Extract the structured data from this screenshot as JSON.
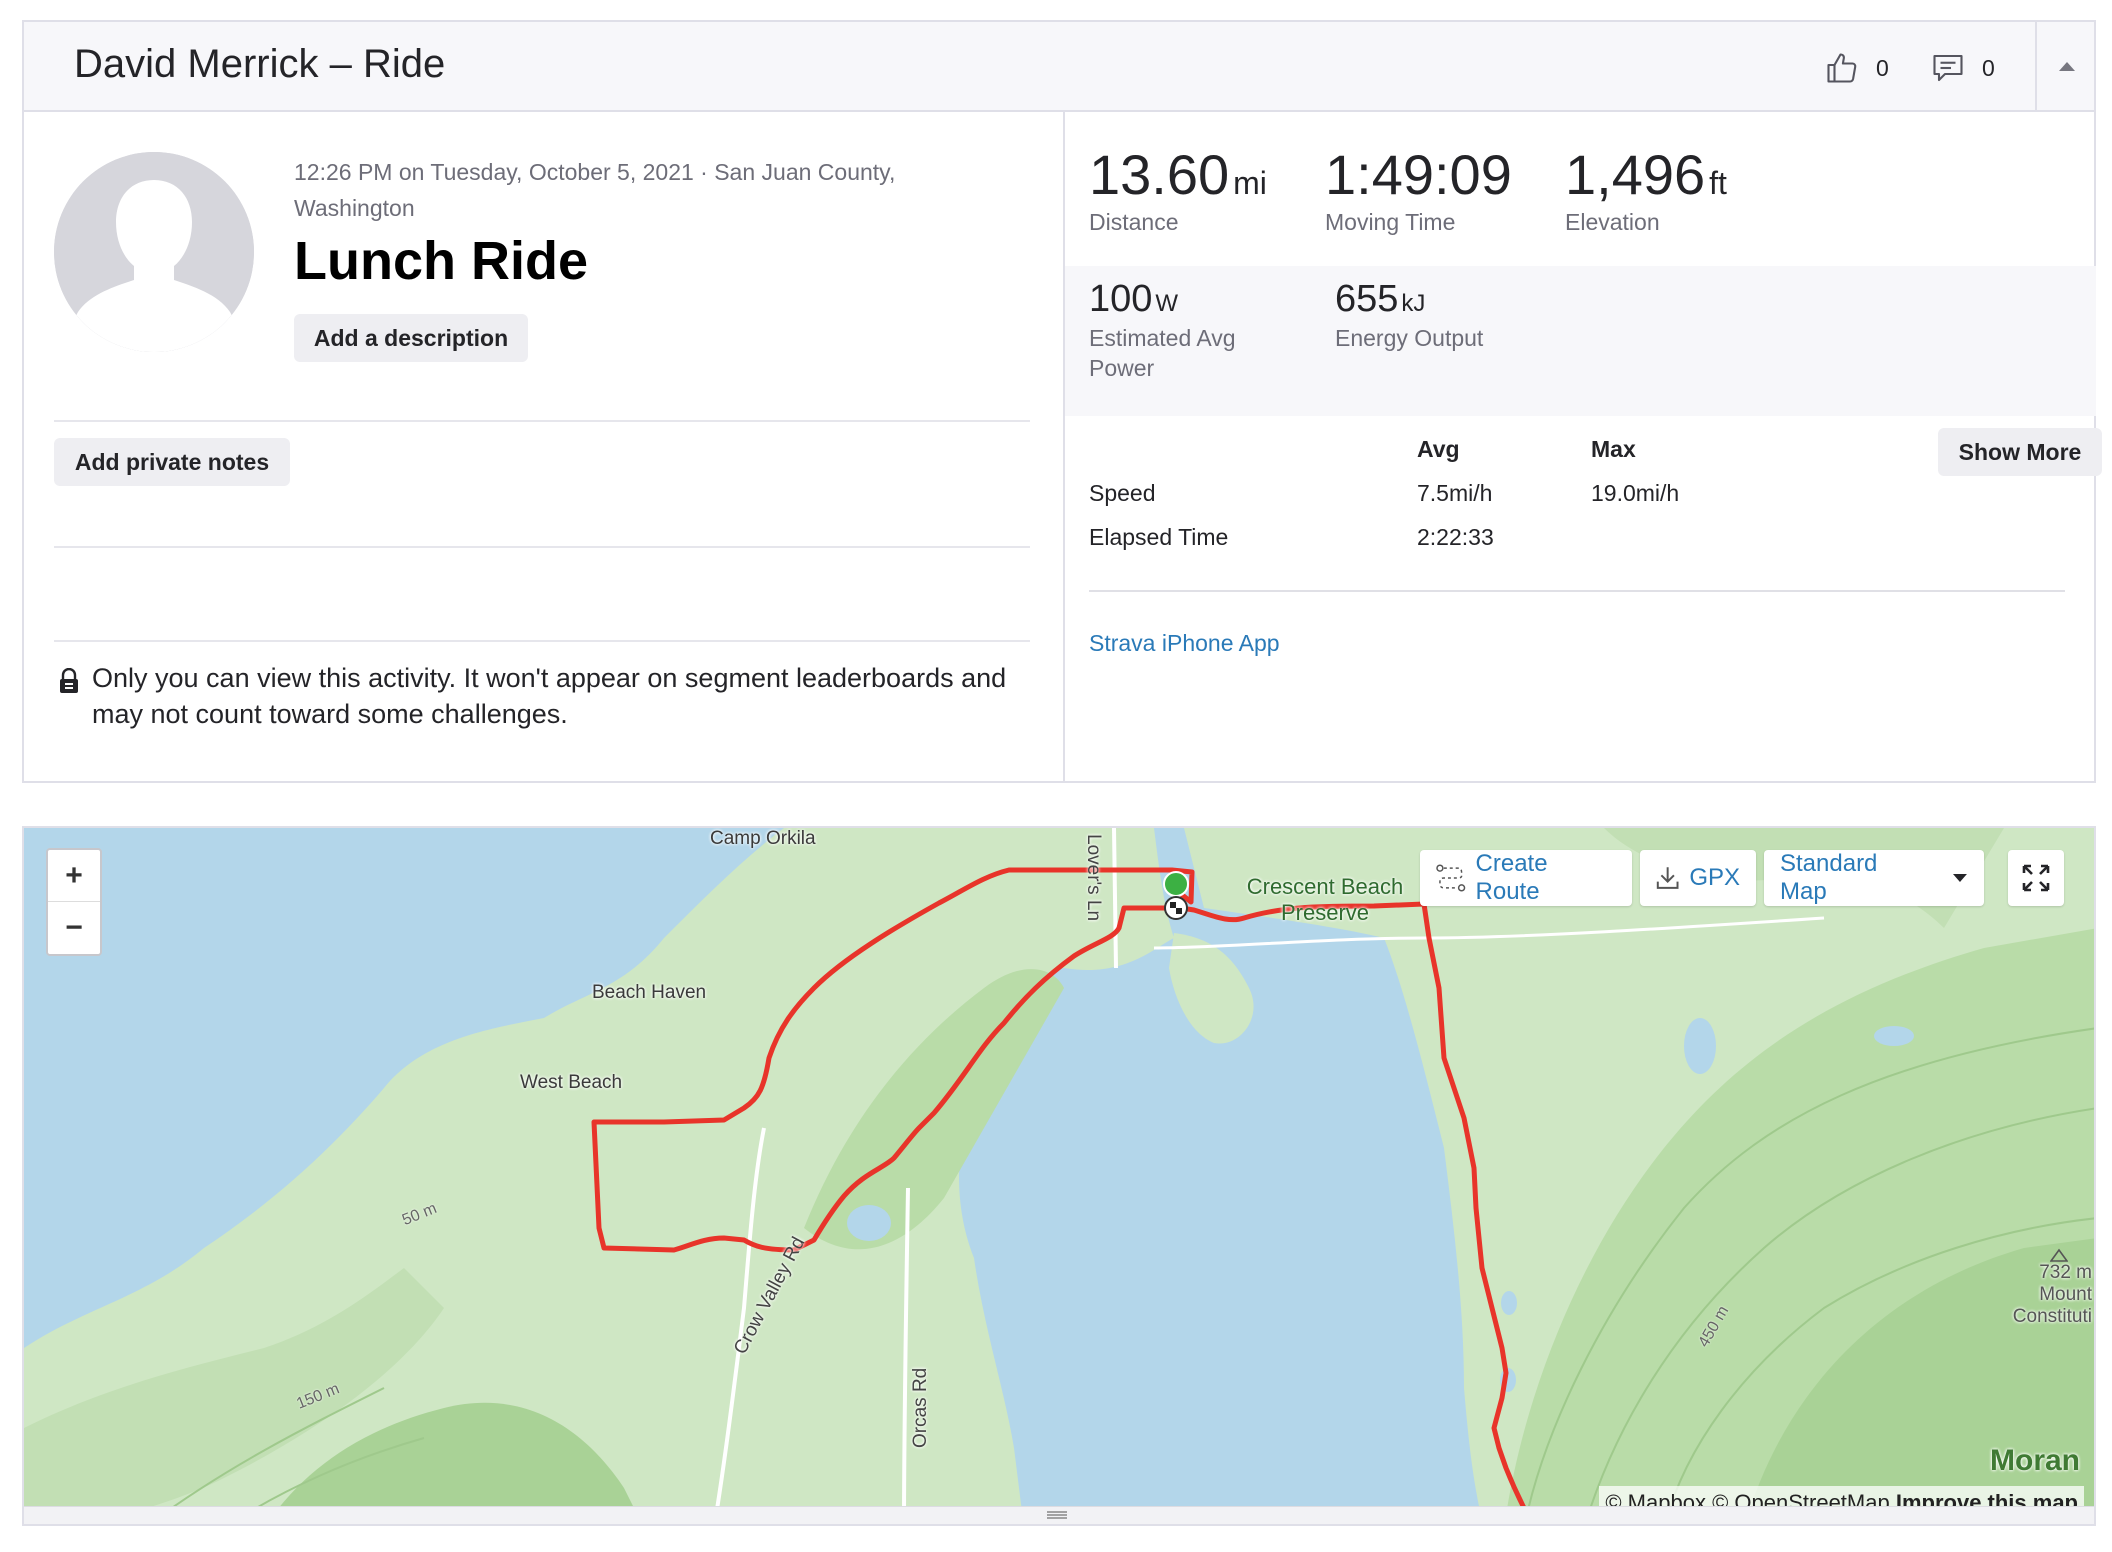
{
  "header": {
    "title": "David Merrick – Ride",
    "kudos_count": "0",
    "comments_count": "0"
  },
  "activity": {
    "meta": "12:26 PM on Tuesday, October 5, 2021 · San Juan County, Washington",
    "title": "Lunch Ride",
    "description_button": "Add a description",
    "private_notes_button": "Add private notes",
    "privacy_notice": "Only you can view this activity. It won't appear on segment leaderboards and may not count toward some challenges."
  },
  "stats": {
    "primary": [
      {
        "value": "13.60",
        "unit": "mi",
        "label": "Distance"
      },
      {
        "value": "1:49:09",
        "unit": "",
        "label": "Moving Time"
      },
      {
        "value": "1,496",
        "unit": "ft",
        "label": "Elevation"
      }
    ],
    "secondary": [
      {
        "value": "100",
        "unit": "W",
        "label": "Estimated Avg Power"
      },
      {
        "value": "655",
        "unit": "kJ",
        "label": "Energy Output"
      }
    ],
    "table": {
      "headers": {
        "avg": "Avg",
        "max": "Max"
      },
      "rows": [
        {
          "label": "Speed",
          "avg": "7.5mi/h",
          "max": "19.0mi/h"
        },
        {
          "label": "Elapsed Time",
          "avg": "2:22:33",
          "max": ""
        }
      ]
    },
    "show_more_button": "Show More",
    "device": "Strava iPhone App"
  },
  "map": {
    "controls": {
      "zoom_in": "+",
      "zoom_out": "−",
      "create_route": "Create Route",
      "gpx": "GPX",
      "map_style": "Standard Map"
    },
    "place_labels": {
      "camp_orkila": "Camp Orkila",
      "lovers_ln": "Lover's Ln",
      "crescent_beach_1": "Crescent Beach",
      "crescent_beach_2": "Preserve",
      "beach_haven": "Beach Haven",
      "west_beach": "West Beach",
      "crow_valley_rd": "Crow Valley Rd",
      "orcas_rd": "Orcas Rd",
      "contour_50": "50 m",
      "contour_150": "150 m",
      "contour_450": "450 m",
      "peak_elev": "732 m",
      "peak_name_1": "Mount",
      "peak_name_2": "Constituti",
      "moran": "Moran"
    },
    "attribution": {
      "mapbox": "© Mapbox",
      "osm": "© OpenStreetMap",
      "improve": "Improve this map"
    },
    "colors": {
      "water": "#b3d6ea",
      "land": "#cfe7c4",
      "route": "#e8342a",
      "start": "#3cb043"
    }
  }
}
